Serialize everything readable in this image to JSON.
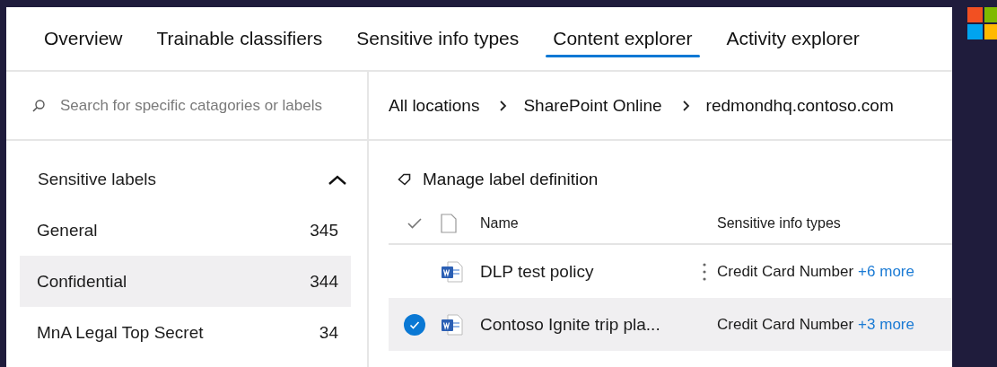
{
  "tabs": [
    {
      "label": "Overview",
      "selected": false
    },
    {
      "label": "Trainable classifiers",
      "selected": false
    },
    {
      "label": "Sensitive info types",
      "selected": false
    },
    {
      "label": "Content explorer",
      "selected": true
    },
    {
      "label": "Activity explorer",
      "selected": false
    }
  ],
  "search": {
    "placeholder": "Search for specific catagories or labels"
  },
  "breadcrumb": [
    "All locations",
    "SharePoint Online",
    "redmondhq.contoso.com"
  ],
  "sidebar": {
    "title": "Sensitive labels",
    "expanded": true,
    "items": [
      {
        "label": "General",
        "count": "345",
        "selected": false
      },
      {
        "label": "Confidential",
        "count": "344",
        "selected": true
      },
      {
        "label": "MnA Legal Top Secret",
        "count": "34",
        "selected": false
      }
    ]
  },
  "toolbar": {
    "action": "Manage label definition"
  },
  "table": {
    "columns": [
      "Name",
      "Sensitive info types"
    ],
    "rows": [
      {
        "name": "DLP test policy",
        "info": "Credit Card Number",
        "more": "+6 more",
        "selected": false,
        "menu_shown": true
      },
      {
        "name": "Contoso Ignite trip pla...",
        "info": "Credit Card Number",
        "more": "+3 more",
        "selected": true,
        "menu_shown": false
      }
    ]
  }
}
